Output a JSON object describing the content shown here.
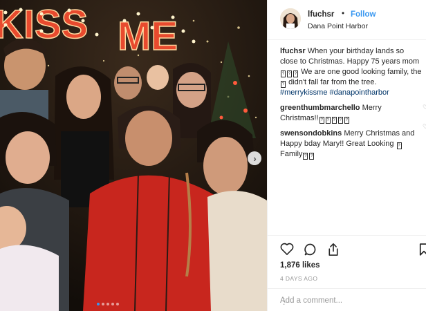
{
  "photo": {
    "sign_text": "KISS ME",
    "carousel_dots": 5,
    "active_dot": 0
  },
  "header": {
    "username": "lfuchsr",
    "separator": "•",
    "follow_label": "Follow",
    "location": "Dana Point Harbor"
  },
  "caption": {
    "username": "lfuchsr",
    "text_part1": "When your birthday lands so close to Christmas. Happy 75 years mom",
    "text_part2": "We are one good looking family, the",
    "text_part3": "didn't fall far from the tree.",
    "hashtag1": "#merrykissme",
    "hashtag2": "#danapointharbor"
  },
  "comments": [
    {
      "username": "greenthumbmarchello",
      "text": "Merry Christmas!!"
    },
    {
      "username": "swensondobkins",
      "text": "Merry Christmas and Happy bday Mary!! Great Looking",
      "text_end": "Family"
    }
  ],
  "stats": {
    "likes": "1,876 likes",
    "time": "4 DAYS AGO"
  },
  "add_comment": {
    "placeholder": "Add a comment..."
  },
  "icons": [
    "heart-icon",
    "comment-icon",
    "share-icon",
    "bookmark-icon",
    "chevron-right-icon"
  ],
  "colors": {
    "link": "#3897f0",
    "hashtag": "#003569",
    "muted": "#999999"
  }
}
